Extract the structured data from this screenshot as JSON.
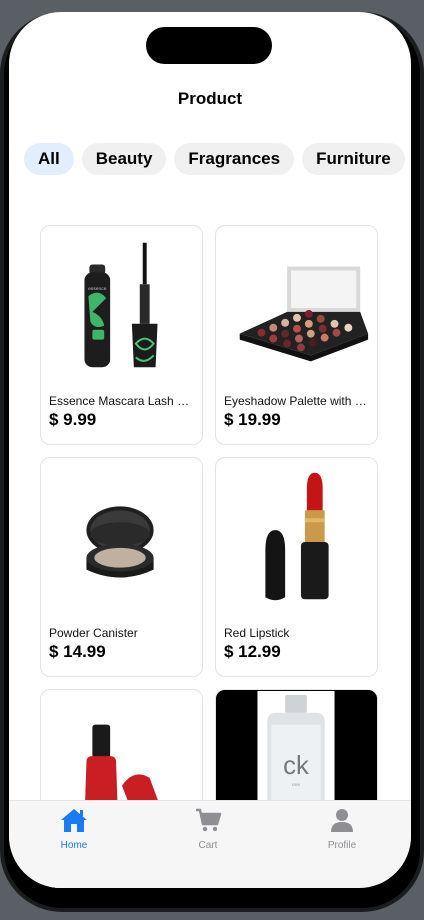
{
  "header": {
    "title": "Product"
  },
  "categories": [
    {
      "label": "All",
      "selected": true
    },
    {
      "label": "Beauty",
      "selected": false
    },
    {
      "label": "Fragrances",
      "selected": false
    },
    {
      "label": "Furniture",
      "selected": false
    }
  ],
  "products": [
    {
      "name": "Essence Mascara Lash Princess",
      "price": "$ 9.99",
      "image": "mascara-image"
    },
    {
      "name": "Eyeshadow Palette with Mirror",
      "price": "$ 19.99",
      "image": "eyeshadow-palette-image"
    },
    {
      "name": "Powder Canister",
      "price": "$ 14.99",
      "image": "powder-canister-image"
    },
    {
      "name": "Red Lipstick",
      "price": "$ 12.99",
      "image": "red-lipstick-image"
    },
    {
      "name": "",
      "price": "",
      "image": "nail-polish-image"
    },
    {
      "name": "",
      "price": "",
      "image": "ck-perfume-bottle-image"
    }
  ],
  "tabbar": {
    "items": [
      {
        "label": "Home",
        "icon": "home-icon",
        "active": true
      },
      {
        "label": "Cart",
        "icon": "cart-icon",
        "active": false
      },
      {
        "label": "Profile",
        "icon": "profile-icon",
        "active": false
      }
    ]
  },
  "colors": {
    "accent": "#1a7cf5",
    "chip_bg": "#f0f0f1",
    "chip_selected_bg": "#e2eefb"
  }
}
